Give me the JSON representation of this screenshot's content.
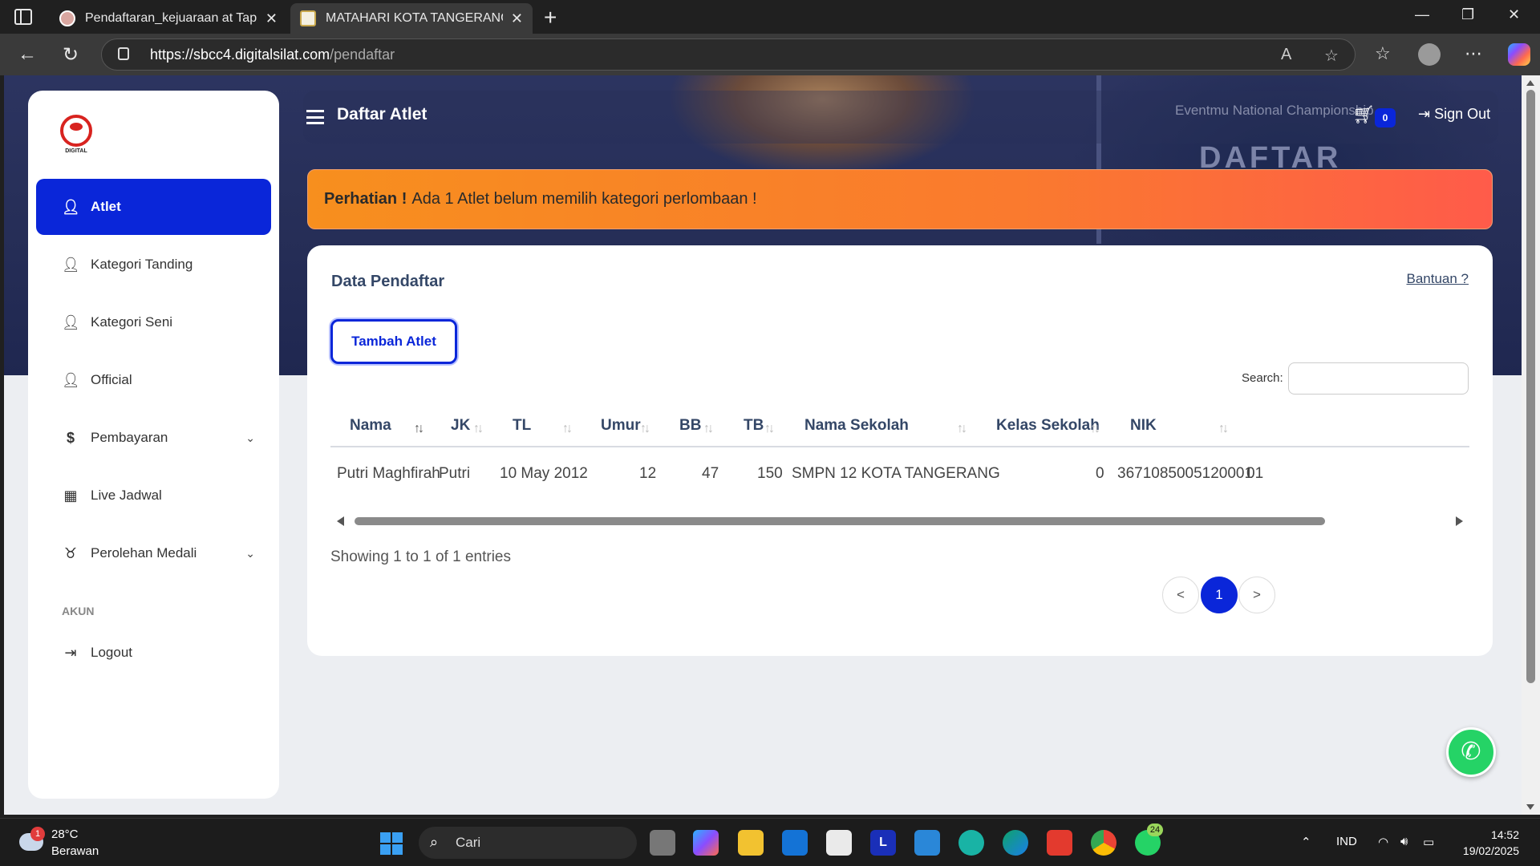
{
  "browser": {
    "tabs": [
      {
        "title": "Pendaftaran_kejuaraan at Taplink"
      },
      {
        "title": "MATAHARI KOTA TANGERANG - S"
      }
    ],
    "url_host": "https://sbcc4.digitalsilat.com",
    "url_path": "/pendaftar"
  },
  "hero": {
    "event_text": "Eventmu National Championship",
    "big_text": "DAFTAR"
  },
  "sidebar": {
    "logo_text": "DIGITAL",
    "items": [
      {
        "label": "Atlet",
        "icon": "user-icon"
      },
      {
        "label": "Kategori Tanding",
        "icon": "user-icon"
      },
      {
        "label": "Kategori Seni",
        "icon": "user-icon"
      },
      {
        "label": "Official",
        "icon": "user-icon"
      },
      {
        "label": "Pembayaran",
        "icon": "dollar-icon"
      },
      {
        "label": "Live Jadwal",
        "icon": "calendar-icon"
      },
      {
        "label": "Perolehan Medali",
        "icon": "medal-icon"
      }
    ],
    "section_akun": "AKUN",
    "logout": "Logout"
  },
  "topnav": {
    "title": "Daftar Atlet",
    "cart_count": "0",
    "signout": "Sign Out"
  },
  "alert": {
    "strong": "Perhatian !",
    "text": "Ada 1 Atlet belum memilih kategori perlombaan !"
  },
  "card": {
    "title": "Data Pendaftar",
    "help": "Bantuan ?",
    "add_button": "Tambah Atlet",
    "search_label": "Search:",
    "search_value": "",
    "columns": [
      "Nama",
      "JK",
      "TL",
      "Umur",
      "BB",
      "TB",
      "Nama Sekolah",
      "Kelas Sekolah",
      "NIK"
    ],
    "rows": [
      [
        "Putri Maghfirah",
        "Putri",
        "10 May 2012",
        "12",
        "47",
        "150",
        "SMPN 12 KOTA TANGERANG",
        "0",
        "3671085005120001",
        "01"
      ]
    ],
    "showing": "Showing 1 to 1 of 1 entries",
    "pagination": {
      "prev": "<",
      "current": "1",
      "next": ">"
    }
  },
  "taskbar": {
    "weather_badge": "1",
    "temp": "28°C",
    "condition": "Berawan",
    "search": "Cari",
    "whatsapp_badge": "24",
    "lang": "IND",
    "time": "14:52",
    "date": "19/02/2025"
  },
  "colors": {
    "accent": "#0a26d9",
    "alert_start": "#f78f1e",
    "alert_end": "#ff5b4a",
    "whatsapp": "#25d366"
  }
}
